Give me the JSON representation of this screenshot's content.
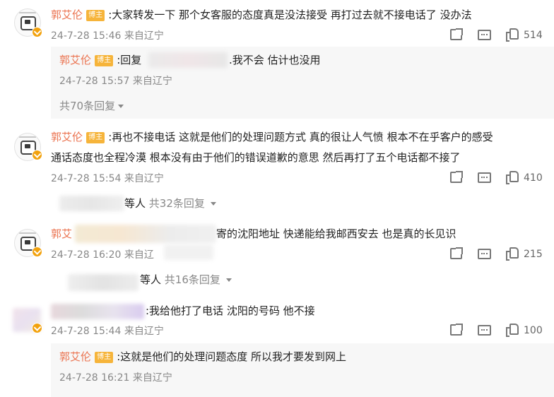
{
  "tag_label": "博主",
  "comments": [
    {
      "name": "郭艾伦",
      "text": ":大家转发一下 那个女客服的态度真是没法接受 再打过去就不接电话了 没办法",
      "time": "24-7-28 15:46 来自辽宁",
      "likes": "514",
      "reply": {
        "name": "郭艾伦",
        "text_prefix": ":回复",
        "text_suffix": ".我不会 估计也没用",
        "time": "24-7-28 15:57 来自辽宁"
      },
      "more": "共70条回复"
    },
    {
      "name": "郭艾伦",
      "text_line1": ":再也不接电话 这就是他们的处理问题方式 真的很让人气愤 根本不在乎客户的感受",
      "text_line2": "通话态度也全程冷漠 根本没有由于他们的错误道歉的意思 然后再打了五个电话都不接了",
      "time": "24-7-28 15:54 来自辽宁",
      "likes": "410",
      "others": "等人",
      "more": "共32条回复"
    },
    {
      "name": "郭艾",
      "text_visible": "寄的沈阳地址 快递能给我邮西安去 也是真的长见识",
      "time_visible": "24-7-28 16:20 来自辽",
      "likes": "215",
      "others": "等人",
      "more": "共16条回复"
    },
    {
      "text": ":我给他打了电话   沈阳的号码   他不接",
      "time": "24-7-28 15:44 来自辽宁",
      "likes": "100",
      "reply": {
        "name": "郭艾伦",
        "text": ":这就是他们的处理问题态度 所以我才要发到网上",
        "time": "24-7-28 16:21 来自辽宁"
      }
    }
  ],
  "colors": {
    "name": "#eb7350",
    "tag": "#f6b43a",
    "meta": "#888888"
  },
  "icons": [
    "share-icon",
    "comment-icon",
    "like-icon",
    "verified-badge-icon",
    "chevron-down-icon"
  ]
}
